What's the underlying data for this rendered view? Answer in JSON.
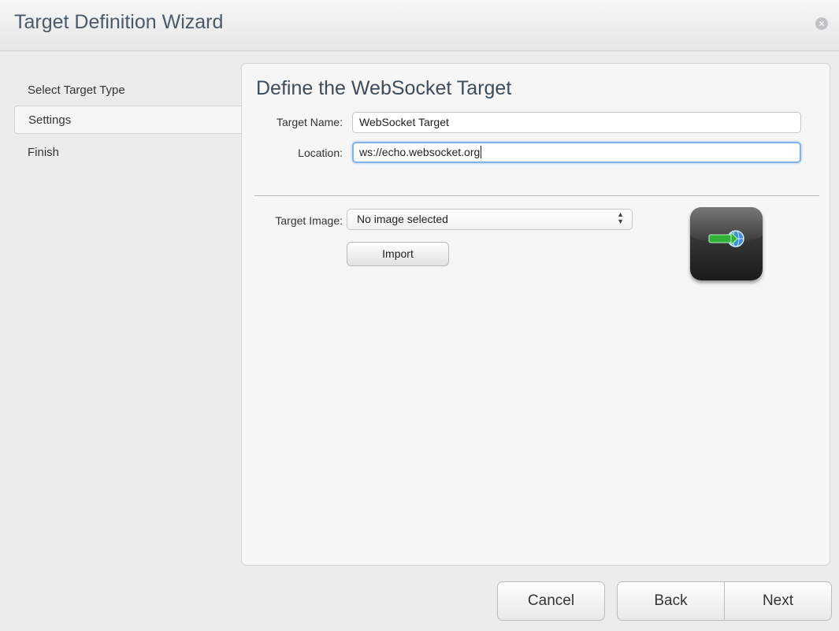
{
  "window": {
    "title": "Target Definition Wizard"
  },
  "sidebar": {
    "items": [
      {
        "label": "Select Target Type"
      },
      {
        "label": "Settings"
      },
      {
        "label": "Finish"
      }
    ]
  },
  "main": {
    "heading": "Define the WebSocket Target",
    "target_name_label": "Target Name:",
    "target_name_value": "WebSocket Target",
    "location_label": "Location:",
    "location_value": "ws://echo.websocket.org",
    "target_image_label": "Target Image:",
    "target_image_value": "No image selected",
    "import_label": "Import",
    "icon": "http-globe-icon"
  },
  "footer": {
    "cancel_label": "Cancel",
    "back_label": "Back",
    "next_label": "Next"
  },
  "colors": {
    "focus_border": "#7fb2e6",
    "title_text": "#4a5a6a"
  }
}
